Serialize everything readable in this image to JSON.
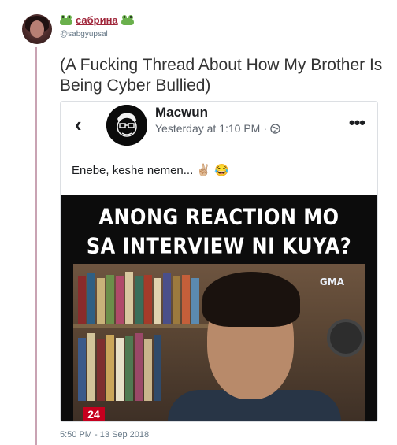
{
  "tweet": {
    "display_name": "сабрина",
    "handle": "@sabgyupsal",
    "text": "(A Fucking Thread About How My Brother Is Being Cyber Bullied)",
    "timestamp": "5:50 PM - 13 Sep 2018"
  },
  "embed": {
    "author_name": "Macwun",
    "post_time": "Yesterday at 1:10 PM",
    "separator": "·",
    "post_text": "Enebe, keshe nemen...",
    "emojis": [
      "✌🏼",
      "😂"
    ],
    "media": {
      "caption_line1": "ANONG REACTION MO",
      "caption_line2": "SA INTERVIEW NI KUYA?",
      "network_logo": "GMA",
      "channel_number": "24"
    }
  },
  "icons": {
    "back": "chevron-left-icon",
    "more": "more-options-icon",
    "privacy": "globe-icon",
    "name_decoration": "frog-icon"
  },
  "colors": {
    "display_name": "#a0263a",
    "thread_line": "#c9a3b3",
    "meta_text": "#657786"
  }
}
